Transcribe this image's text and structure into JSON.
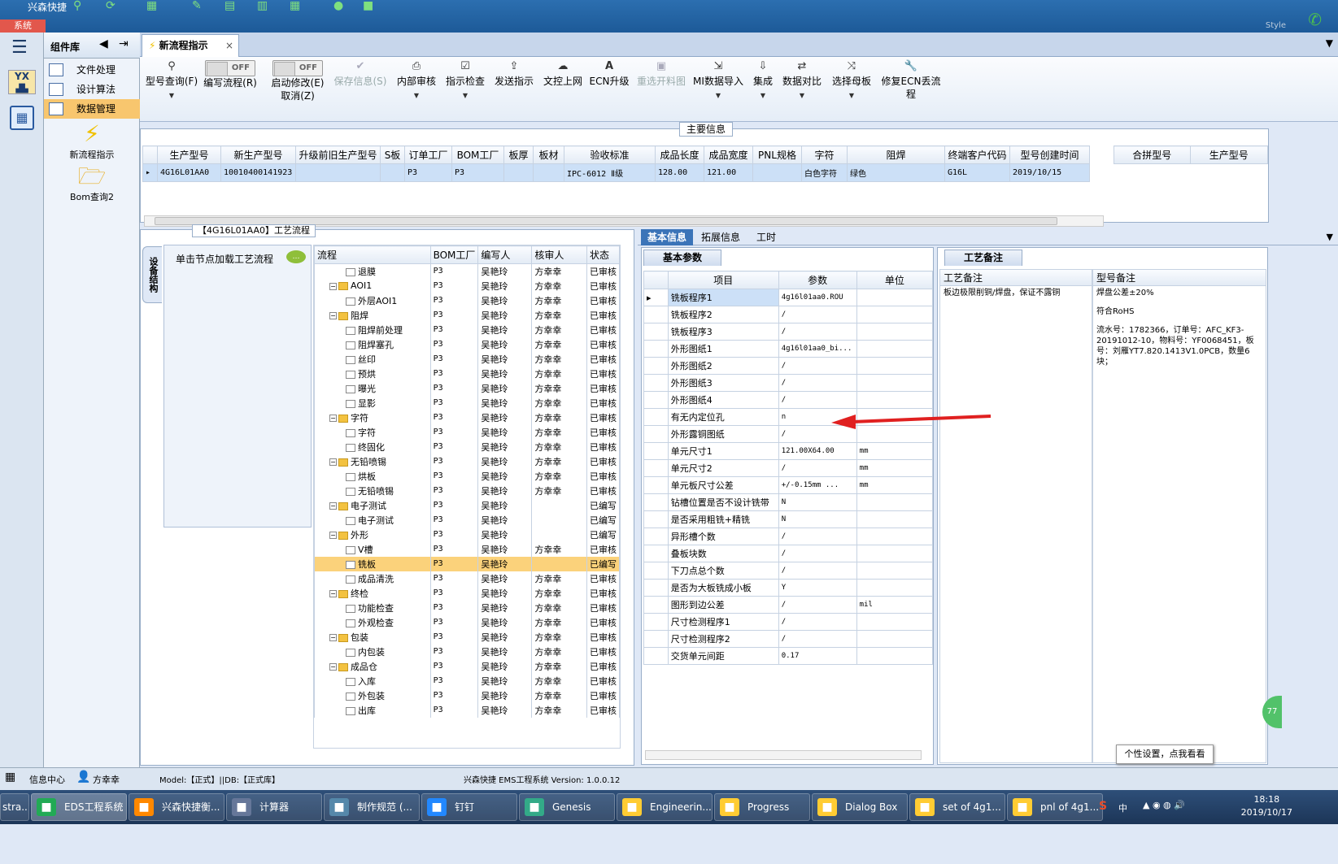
{
  "topbar": {
    "app_title": "兴森快捷",
    "system_label": "系统",
    "style_label": "Style"
  },
  "sidebar": {
    "yx_label": "YX"
  },
  "component_library": {
    "title": "组件库",
    "items": [
      {
        "label": "文件处理"
      },
      {
        "label": "设计算法"
      },
      {
        "label": "数据管理"
      }
    ],
    "shortcuts": [
      {
        "label": "新流程指示"
      },
      {
        "label": "Bom查询2"
      }
    ]
  },
  "tab": {
    "label": "新流程指示",
    "close": "×"
  },
  "toolbar": {
    "items": [
      {
        "label": "型号查询(F)"
      },
      {
        "label": "编写流程(R)",
        "toggle": "OFF"
      },
      {
        "label": "启动修改(E)",
        "label2": "取消(Z)",
        "toggle": "OFF"
      },
      {
        "label": "保存信息(S)"
      },
      {
        "label": "内部审核"
      },
      {
        "label": "指示检查"
      },
      {
        "label": "发送指示"
      },
      {
        "label": "文控上网"
      },
      {
        "label": "ECN升级"
      },
      {
        "label": "重选开料图"
      },
      {
        "label": "MI数据导入"
      },
      {
        "label": "集成"
      },
      {
        "label": "数据对比"
      },
      {
        "label": "选择母板"
      },
      {
        "label": "修复ECN丢流程"
      }
    ]
  },
  "main_info": {
    "title": "主要信息",
    "columns": [
      "生产型号",
      "新生产型号",
      "升级前旧生产型号",
      "S板",
      "订单工厂",
      "BOM工厂",
      "板厚",
      "板材",
      "验收标准",
      "成品长度",
      "成品宽度",
      "PNL规格",
      "字符",
      "阻焊",
      "终端客户代码",
      "型号创建时间"
    ],
    "row": [
      "4G16L01AA0",
      "10010400141923",
      "",
      "",
      "P3",
      "P3",
      "",
      "",
      "IPC-6012 Ⅱ级",
      "128.00",
      "121.00",
      "",
      "白色字符",
      "绿色",
      "G16L",
      "2019/10/15"
    ],
    "side_columns": [
      "合拼型号",
      "生产型号"
    ]
  },
  "flow": {
    "title": "【4G16L01AA0】工艺流程",
    "vertical_tab": "设备结构",
    "hint": "单击节点加载工艺流程",
    "columns": [
      "流程",
      "BOM工厂",
      "编写人",
      "核审人",
      "状态"
    ],
    "rows": [
      {
        "name": "退膜",
        "level": 2,
        "folder": false,
        "bom": "P3",
        "writer": "吴艳玲",
        "reviewer": "方幸幸",
        "status": "已审核"
      },
      {
        "name": "AOI1",
        "level": 1,
        "folder": true,
        "bom": "P3",
        "writer": "吴艳玲",
        "reviewer": "方幸幸",
        "status": "已审核"
      },
      {
        "name": "外层AOI1",
        "level": 2,
        "folder": false,
        "bom": "P3",
        "writer": "吴艳玲",
        "reviewer": "方幸幸",
        "status": "已审核"
      },
      {
        "name": "阻焊",
        "level": 1,
        "folder": true,
        "bom": "P3",
        "writer": "吴艳玲",
        "reviewer": "方幸幸",
        "status": "已审核"
      },
      {
        "name": "阻焊前处理",
        "level": 2,
        "folder": false,
        "bom": "P3",
        "writer": "吴艳玲",
        "reviewer": "方幸幸",
        "status": "已审核"
      },
      {
        "name": "阻焊塞孔",
        "level": 2,
        "folder": false,
        "bom": "P3",
        "writer": "吴艳玲",
        "reviewer": "方幸幸",
        "status": "已审核"
      },
      {
        "name": "丝印",
        "level": 2,
        "folder": false,
        "bom": "P3",
        "writer": "吴艳玲",
        "reviewer": "方幸幸",
        "status": "已审核"
      },
      {
        "name": "预烘",
        "level": 2,
        "folder": false,
        "bom": "P3",
        "writer": "吴艳玲",
        "reviewer": "方幸幸",
        "status": "已审核"
      },
      {
        "name": "曝光",
        "level": 2,
        "folder": false,
        "bom": "P3",
        "writer": "吴艳玲",
        "reviewer": "方幸幸",
        "status": "已审核"
      },
      {
        "name": "显影",
        "level": 2,
        "folder": false,
        "bom": "P3",
        "writer": "吴艳玲",
        "reviewer": "方幸幸",
        "status": "已审核"
      },
      {
        "name": "字符",
        "level": 1,
        "folder": true,
        "bom": "P3",
        "writer": "吴艳玲",
        "reviewer": "方幸幸",
        "status": "已审核"
      },
      {
        "name": "字符",
        "level": 2,
        "folder": false,
        "bom": "P3",
        "writer": "吴艳玲",
        "reviewer": "方幸幸",
        "status": "已审核"
      },
      {
        "name": "终固化",
        "level": 2,
        "folder": false,
        "bom": "P3",
        "writer": "吴艳玲",
        "reviewer": "方幸幸",
        "status": "已审核"
      },
      {
        "name": "无铅喷锡",
        "level": 1,
        "folder": true,
        "bom": "P3",
        "writer": "吴艳玲",
        "reviewer": "方幸幸",
        "status": "已审核"
      },
      {
        "name": "烘板",
        "level": 2,
        "folder": false,
        "bom": "P3",
        "writer": "吴艳玲",
        "reviewer": "方幸幸",
        "status": "已审核"
      },
      {
        "name": "无铅喷锡",
        "level": 2,
        "folder": false,
        "bom": "P3",
        "writer": "吴艳玲",
        "reviewer": "方幸幸",
        "status": "已审核"
      },
      {
        "name": "电子测试",
        "level": 1,
        "folder": true,
        "bom": "P3",
        "writer": "吴艳玲",
        "reviewer": "",
        "status": "已编写"
      },
      {
        "name": "电子测试",
        "level": 2,
        "folder": false,
        "bom": "P3",
        "writer": "吴艳玲",
        "reviewer": "",
        "status": "已编写"
      },
      {
        "name": "外形",
        "level": 1,
        "folder": true,
        "bom": "P3",
        "writer": "吴艳玲",
        "reviewer": "",
        "status": "已编写"
      },
      {
        "name": "V槽",
        "level": 2,
        "folder": false,
        "bom": "P3",
        "writer": "吴艳玲",
        "reviewer": "方幸幸",
        "status": "已审核"
      },
      {
        "name": "铣板",
        "level": 2,
        "folder": false,
        "bom": "P3",
        "writer": "吴艳玲",
        "reviewer": "",
        "status": "已编写",
        "selected": true
      },
      {
        "name": "成品清洗",
        "level": 2,
        "folder": false,
        "bom": "P3",
        "writer": "吴艳玲",
        "reviewer": "方幸幸",
        "status": "已审核"
      },
      {
        "name": "终检",
        "level": 1,
        "folder": true,
        "bom": "P3",
        "writer": "吴艳玲",
        "reviewer": "方幸幸",
        "status": "已审核"
      },
      {
        "name": "功能检查",
        "level": 2,
        "folder": false,
        "bom": "P3",
        "writer": "吴艳玲",
        "reviewer": "方幸幸",
        "status": "已审核"
      },
      {
        "name": "外观检查",
        "level": 2,
        "folder": false,
        "bom": "P3",
        "writer": "吴艳玲",
        "reviewer": "方幸幸",
        "status": "已审核"
      },
      {
        "name": "包装",
        "level": 1,
        "folder": true,
        "bom": "P3",
        "writer": "吴艳玲",
        "reviewer": "方幸幸",
        "status": "已审核"
      },
      {
        "name": "内包装",
        "level": 2,
        "folder": false,
        "bom": "P3",
        "writer": "吴艳玲",
        "reviewer": "方幸幸",
        "status": "已审核"
      },
      {
        "name": "成品仓",
        "level": 1,
        "folder": true,
        "bom": "P3",
        "writer": "吴艳玲",
        "reviewer": "方幸幸",
        "status": "已审核"
      },
      {
        "name": "入库",
        "level": 2,
        "folder": false,
        "bom": "P3",
        "writer": "吴艳玲",
        "reviewer": "方幸幸",
        "status": "已审核"
      },
      {
        "name": "外包装",
        "level": 2,
        "folder": false,
        "bom": "P3",
        "writer": "吴艳玲",
        "reviewer": "方幸幸",
        "status": "已审核"
      },
      {
        "name": "出库",
        "level": 2,
        "folder": false,
        "bom": "P3",
        "writer": "吴艳玲",
        "reviewer": "方幸幸",
        "status": "已审核"
      }
    ]
  },
  "right_tabs": [
    "基本信息",
    "拓展信息",
    "工时"
  ],
  "basic_params": {
    "title": "基本参数",
    "columns": [
      "项目",
      "参数",
      "单位"
    ],
    "rows": [
      {
        "item": "铣板程序1",
        "param": "4g16l01aa0.ROU",
        "unit": "",
        "selected": true
      },
      {
        "item": "铣板程序2",
        "param": "/",
        "unit": ""
      },
      {
        "item": "铣板程序3",
        "param": "/",
        "unit": ""
      },
      {
        "item": "外形图纸1",
        "param": "4g16l01aa0_bi...",
        "unit": ""
      },
      {
        "item": "外形图纸2",
        "param": "/",
        "unit": ""
      },
      {
        "item": "外形图纸3",
        "param": "/",
        "unit": ""
      },
      {
        "item": "外形图纸4",
        "param": "/",
        "unit": ""
      },
      {
        "item": "有无内定位孔",
        "param": "n",
        "unit": ""
      },
      {
        "item": "外形露铜图纸",
        "param": "/",
        "unit": ""
      },
      {
        "item": "单元尺寸1",
        "param": "121.00X64.00",
        "unit": "mm"
      },
      {
        "item": "单元尺寸2",
        "param": "/",
        "unit": "mm"
      },
      {
        "item": "单元板尺寸公差",
        "param": "+/-0.15mm   ...",
        "unit": "mm"
      },
      {
        "item": "钻槽位置是否不设计铣带",
        "param": "N",
        "unit": ""
      },
      {
        "item": "是否采用粗铣+精铣",
        "param": "N",
        "unit": ""
      },
      {
        "item": "异形槽个数",
        "param": "/",
        "unit": ""
      },
      {
        "item": "叠板块数",
        "param": "/",
        "unit": ""
      },
      {
        "item": "下刀点总个数",
        "param": "/",
        "unit": ""
      },
      {
        "item": "是否为大板铣成小板",
        "param": "Y",
        "unit": ""
      },
      {
        "item": "图形到边公差",
        "param": "/",
        "unit": "mil"
      },
      {
        "item": "尺寸检测程序1",
        "param": "/",
        "unit": ""
      },
      {
        "item": "尺寸检测程序2",
        "param": "/",
        "unit": ""
      },
      {
        "item": "交货单元间距",
        "param": "0.17",
        "unit": ""
      }
    ]
  },
  "process_notes": {
    "title": "工艺备注",
    "col1_header": "工艺备注",
    "col1_text": "板边极限削铜/焊盘，保证不露铜",
    "col2_header": "型号备注",
    "col2_lines": [
      "焊盘公差±20%",
      "符合RoHS",
      "流水号：1782366，订单号：AFC_KF3-20191012-10，物料号：YF0068451，板号：刘雁YT7.820.1413V1.0PCB，数量6块；"
    ]
  },
  "statusbar": {
    "info_center": "信息中心",
    "user": "方幸幸",
    "model": "Model:【正式】||DB:【正式库】",
    "version": "兴森快捷 EMS工程系统 Version: 1.0.0.12"
  },
  "tooltip": "个性设置，点我看看",
  "green_badge": "77",
  "taskbar": {
    "items": [
      {
        "label": "stra..."
      },
      {
        "label": "EDS工程系统"
      },
      {
        "label": "兴森快捷衡..."
      },
      {
        "label": "计算器"
      },
      {
        "label": "制作规范 (..."
      },
      {
        "label": "钉钉"
      },
      {
        "label": "Genesis"
      },
      {
        "label": "Engineerin..."
      },
      {
        "label": "Progress"
      },
      {
        "label": "Dialog Box"
      },
      {
        "label": "set of 4g1..."
      },
      {
        "label": "pnl of 4g1..."
      }
    ],
    "time": "18:18",
    "date": "2019/10/17",
    "ime": "中"
  },
  "colors": {
    "selection_row": "#fbd27b",
    "accent": "#3b74b8",
    "arrow": "#e02020"
  }
}
